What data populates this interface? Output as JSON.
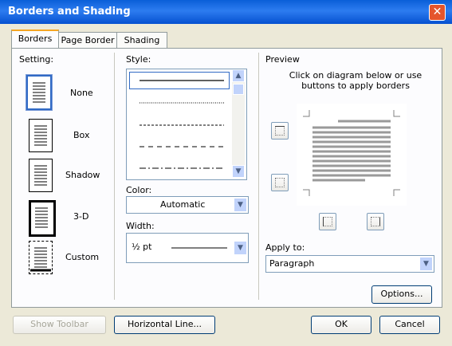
{
  "window": {
    "title": "Borders and Shading",
    "close_glyph": "✕"
  },
  "tabs": [
    {
      "label": "Borders",
      "active": true
    },
    {
      "label": "Page Border",
      "active": false
    },
    {
      "label": "Shading",
      "active": false
    }
  ],
  "setting": {
    "heading": "Setting:",
    "items": [
      {
        "label": "None",
        "selected": true
      },
      {
        "label": "Box",
        "selected": false
      },
      {
        "label": "Shadow",
        "selected": false
      },
      {
        "label": "3-D",
        "selected": false
      },
      {
        "label": "Custom",
        "selected": false
      }
    ]
  },
  "style": {
    "heading": "Style:",
    "line_styles": [
      "solid",
      "dotted",
      "dashed-small",
      "dashed",
      "dash-dot"
    ]
  },
  "color": {
    "label": "Color:",
    "value": "Automatic"
  },
  "width": {
    "label": "Width:",
    "value": "½ pt"
  },
  "preview": {
    "heading": "Preview",
    "hint": "Click on diagram below or use buttons to apply borders"
  },
  "apply_to": {
    "label": "Apply to:",
    "value": "Paragraph"
  },
  "buttons": {
    "options": "Options...",
    "show_toolbar": "Show Toolbar",
    "horizontal_line": "Horizontal Line...",
    "ok": "OK",
    "cancel": "Cancel"
  },
  "colors": {
    "title_bar": "#0a5fd8",
    "accent_tab": "#f5a623",
    "selection": "#316ac5"
  }
}
